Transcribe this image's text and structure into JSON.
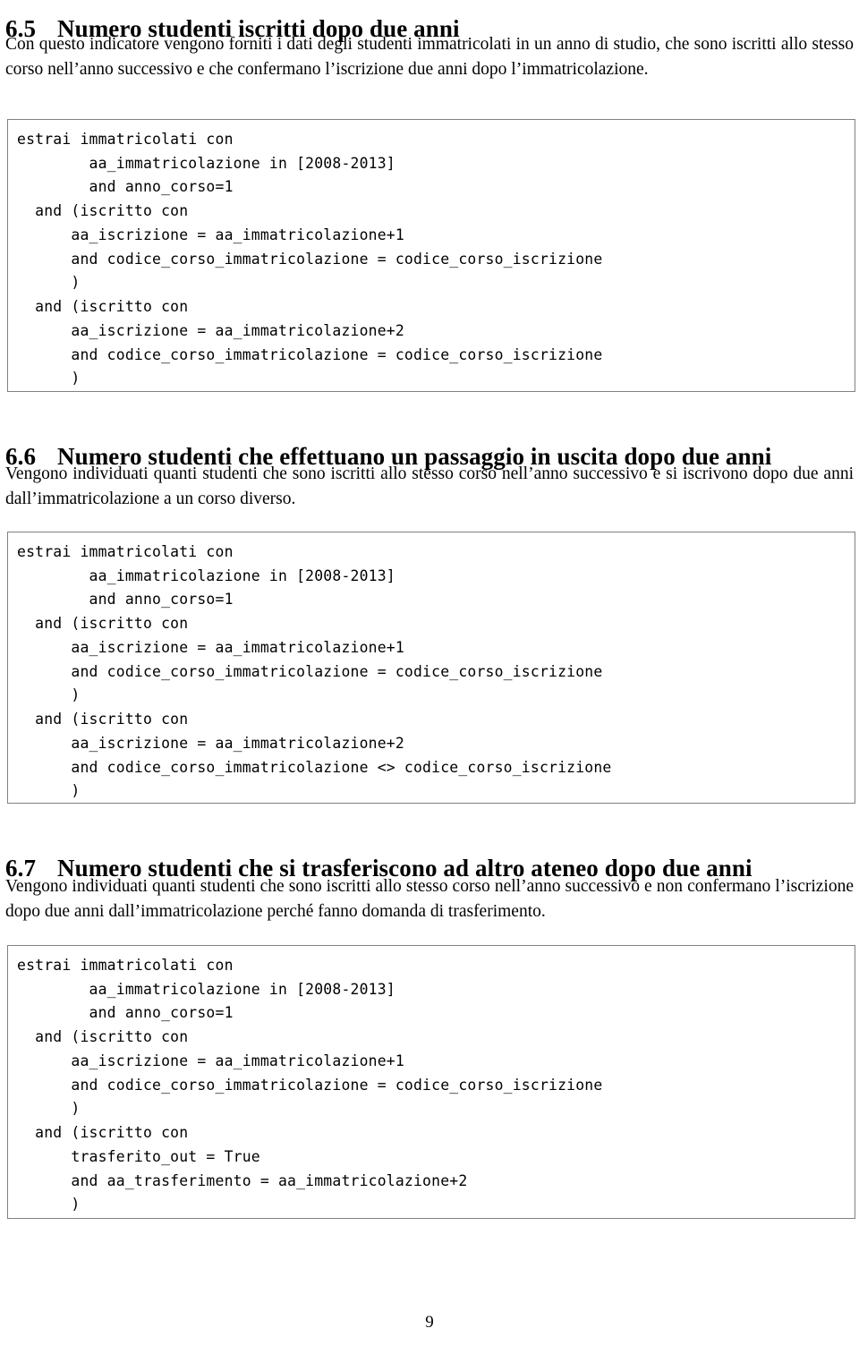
{
  "document": {
    "page_number": "9",
    "sections": [
      {
        "number": "6.5",
        "title": "Numero studenti iscritti dopo due anni",
        "paragraph": "Con questo indicatore vengono forniti i dati degli studenti immatricolati in un anno di studio, che sono iscritti allo stesso corso nell’anno successivo e che confermano l’iscrizione due anni dopo l’immatricolazione.",
        "code": "estrai immatricolati con\n        aa_immatricolazione in [2008-2013]\n        and anno_corso=1\n  and (iscritto con\n      aa_iscrizione = aa_immatricolazione+1\n      and codice_corso_immatricolazione = codice_corso_iscrizione\n      )\n  and (iscritto con\n      aa_iscrizione = aa_immatricolazione+2\n      and codice_corso_immatricolazione = codice_corso_iscrizione\n      )"
      },
      {
        "number": "6.6",
        "title": "Numero studenti che effettuano un passaggio in uscita dopo due anni",
        "paragraph": "Vengono individuati quanti studenti che sono iscritti allo stesso corso nell’anno successivo e si iscrivono dopo due anni dall’immatricolazione a un corso diverso.",
        "code": "estrai immatricolati con\n        aa_immatricolazione in [2008-2013]\n        and anno_corso=1\n  and (iscritto con\n      aa_iscrizione = aa_immatricolazione+1\n      and codice_corso_immatricolazione = codice_corso_iscrizione\n      )\n  and (iscritto con\n      aa_iscrizione = aa_immatricolazione+2\n      and codice_corso_immatricolazione <> codice_corso_iscrizione\n      )"
      },
      {
        "number": "6.7",
        "title": "Numero studenti che si trasferiscono ad altro ateneo dopo due anni",
        "paragraph": "Vengono individuati quanti studenti che sono iscritti allo stesso corso nell’anno successivo e non confermano l’iscrizione dopo due anni dall’immatricolazione perché fanno domanda di trasferimento.",
        "code": "estrai immatricolati con\n        aa_immatricolazione in [2008-2013]\n        and anno_corso=1\n  and (iscritto con\n      aa_iscrizione = aa_immatricolazione+1\n      and codice_corso_immatricolazione = codice_corso_iscrizione\n      )\n  and (iscritto con\n      trasferito_out = True\n      and aa_trasferimento = aa_immatricolazione+2\n      )"
      }
    ],
    "colors": {
      "text": "#000000",
      "page_background": "#ffffff",
      "code_box_border": "#808080"
    }
  }
}
